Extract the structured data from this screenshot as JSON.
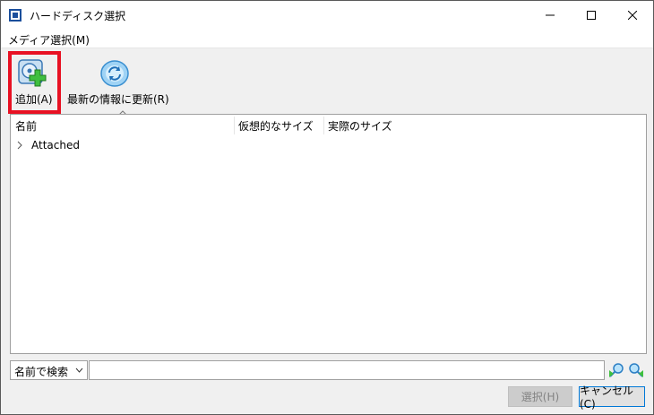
{
  "window": {
    "title": "ハードディスク選択",
    "controls": {
      "minimize": "minimize",
      "maximize": "maximize",
      "close": "close"
    }
  },
  "menu": {
    "media": "メディア選択(M)"
  },
  "toolbar": {
    "add_label": "追加(A)",
    "refresh_label": "最新の情報に更新(R)"
  },
  "list": {
    "columns": [
      "名前",
      "仮想的なサイズ",
      "実際のサイズ"
    ],
    "groups": [
      {
        "label": "Attached",
        "expanded": false
      }
    ]
  },
  "search": {
    "mode": "名前で検索",
    "value": ""
  },
  "buttons": {
    "select": "選択(H)",
    "cancel": "キャンセル(C)"
  },
  "colors": {
    "highlight": "#e81123",
    "accent_border": "#0078d7",
    "disabled_text": "#838383"
  }
}
